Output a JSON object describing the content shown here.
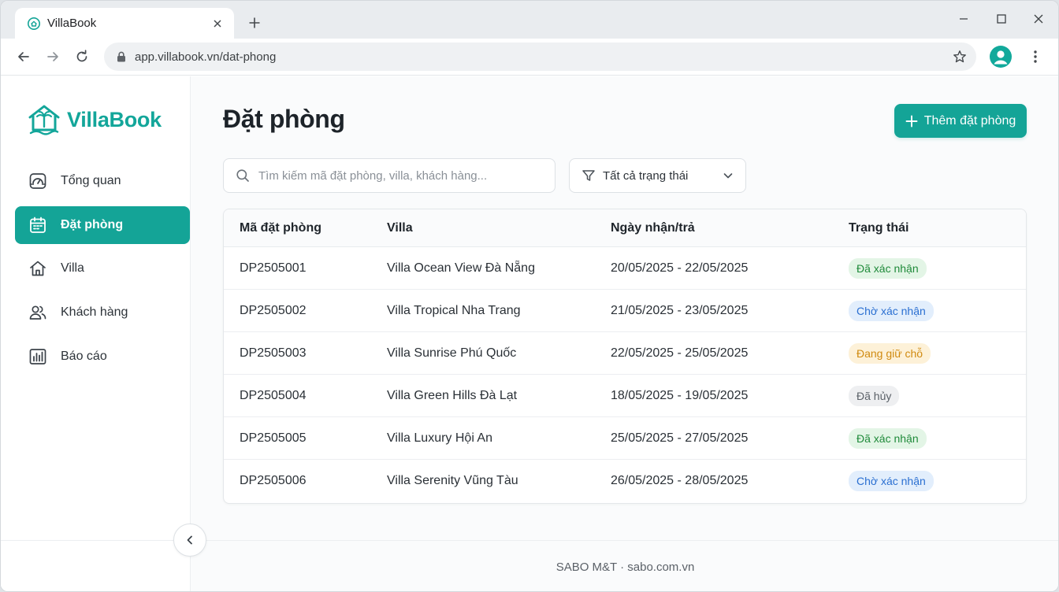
{
  "browser": {
    "tab_title": "VillaBook",
    "url": "app.villabook.vn/dat-phong"
  },
  "app": {
    "logo_text": "VillaBook",
    "brand_color": "#14a497"
  },
  "sidebar": {
    "items": [
      {
        "label": "Tổng quan",
        "icon": "dashboard-icon",
        "active": false
      },
      {
        "label": "Đặt phòng",
        "icon": "calendar-icon",
        "active": true
      },
      {
        "label": "Villa",
        "icon": "home-icon",
        "active": false
      },
      {
        "label": "Khách hàng",
        "icon": "users-icon",
        "active": false
      },
      {
        "label": "Báo cáo",
        "icon": "chart-icon",
        "active": false
      }
    ]
  },
  "main": {
    "title": "Đặt phòng",
    "add_button_label": "Thêm đặt phòng",
    "search_placeholder": "Tìm kiếm mã đặt phòng, villa, khách hàng...",
    "search_value": "",
    "filter_label": "Tất cả trạng thái"
  },
  "table": {
    "headers": [
      "Mã đặt phòng",
      "Villa",
      "Ngày nhận/trả",
      "Trạng thái"
    ],
    "rows": [
      {
        "code": "DP2505001",
        "villa": "Villa Ocean View Đà Nẵng",
        "dates": "20/05/2025 - 22/05/2025",
        "status": "Đã xác nhận",
        "status_type": "confirmed"
      },
      {
        "code": "DP2505002",
        "villa": "Villa Tropical Nha Trang",
        "dates": "21/05/2025 - 23/05/2025",
        "status": "Chờ xác nhận",
        "status_type": "pending"
      },
      {
        "code": "DP2505003",
        "villa": "Villa Sunrise Phú Quốc",
        "dates": "22/05/2025 - 25/05/2025",
        "status": "Đang giữ chỗ",
        "status_type": "holding"
      },
      {
        "code": "DP2505004",
        "villa": "Villa Green Hills Đà Lạt",
        "dates": "18/05/2025 - 19/05/2025",
        "status": "Đã hủy",
        "status_type": "cancelled"
      },
      {
        "code": "DP2505005",
        "villa": "Villa Luxury Hội An",
        "dates": "25/05/2025 - 27/05/2025",
        "status": "Đã xác nhận",
        "status_type": "confirmed"
      },
      {
        "code": "DP2505006",
        "villa": "Villa Serenity Vũng Tàu",
        "dates": "26/05/2025 - 28/05/2025",
        "status": "Chờ xác nhận",
        "status_type": "pending"
      }
    ],
    "status_colors": {
      "confirmed": {
        "bg": "#e3f5e6",
        "fg": "#1f8a3a"
      },
      "pending": {
        "bg": "#e2eefc",
        "fg": "#2a6fd1"
      },
      "holding": {
        "bg": "#fdf1d8",
        "fg": "#d08a10"
      },
      "cancelled": {
        "bg": "#eeeff1",
        "fg": "#5b6168"
      }
    }
  },
  "footer": {
    "text": "SABO M&T · sabo.com.vn"
  }
}
